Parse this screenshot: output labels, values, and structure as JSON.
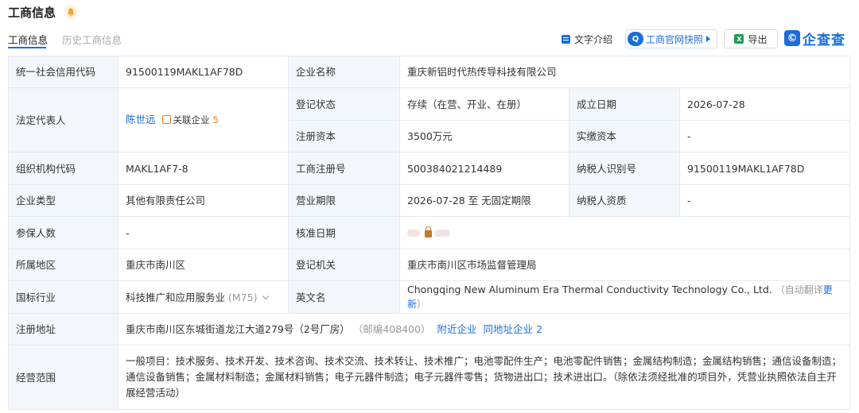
{
  "header": {
    "title": "工商信息"
  },
  "tabs": [
    {
      "label": "工商信息",
      "active": true
    },
    {
      "label": "历史工商信息",
      "active": false
    }
  ],
  "toolbar": {
    "text_intro": "文字介绍",
    "snapshot": "工商官网快照",
    "snapshot_icon": "Q",
    "export": "导出",
    "export_icon": "X",
    "logo_mark": "©",
    "logo_text": "企查查"
  },
  "fields": {
    "credit_code": {
      "label": "统一社会信用代码",
      "value": "91500119MAKL1AF78D"
    },
    "company_name": {
      "label": "企业名称",
      "value": "重庆新铝时代热传导科技有限公司"
    },
    "legal_rep": {
      "label": "法定代表人",
      "value": "陈世远",
      "related_label": "关联企业",
      "related_count": "5"
    },
    "status": {
      "label": "登记状态",
      "value": "存续（在营、开业、在册）"
    },
    "found_date": {
      "label": "成立日期",
      "value": "2026-07-28"
    },
    "reg_capital": {
      "label": "注册资本",
      "value": "3500万元"
    },
    "paid_capital": {
      "label": "实缴资本",
      "value": "-"
    },
    "org_code": {
      "label": "组织机构代码",
      "value": "MAKL1AF7-8"
    },
    "reg_no": {
      "label": "工商注册号",
      "value": "500384021214489"
    },
    "taxpayer_id": {
      "label": "纳税人识别号",
      "value": "91500119MAKL1AF78D"
    },
    "company_type": {
      "label": "企业类型",
      "value": "其他有限责任公司"
    },
    "biz_term": {
      "label": "营业期限",
      "value": "2026-07-28 至 无固定期限"
    },
    "taxpayer_qual": {
      "label": "纳税人资质",
      "value": "-"
    },
    "insured": {
      "label": "参保人数",
      "value": "-"
    },
    "approve_date": {
      "label": "核准日期"
    },
    "region": {
      "label": "所属地区",
      "value": "重庆市南川区"
    },
    "reg_authority": {
      "label": "登记机关",
      "value": "重庆市南川区市场监督管理局"
    },
    "industry": {
      "label": "国标行业",
      "value": "科技推广和应用服务业",
      "code": "(M75)"
    },
    "english_name": {
      "label": "英文名",
      "value": "Chongqing New Aluminum Era Thermal Conductivity Technology Co., Ltd.",
      "note": "（自动翻译",
      "update": "更新",
      "note_end": "）"
    },
    "address": {
      "label": "注册地址",
      "value": "重庆市南川区东城街道龙江大道279号（2号厂房）",
      "postcode": "（邮编408400）",
      "nearby": "附近企业",
      "same_addr": "同地址企业",
      "same_count": "2"
    },
    "scope": {
      "label": "经营范围",
      "value": "一般项目：技术服务、技术开发、技术咨询、技术交流、技术转让、技术推广；电池零配件生产；电池零配件销售；金属结构制造；金属结构销售；通信设备制造；通信设备销售；金属材料制造；金属材料销售；电子元器件制造；电子元器件零售；货物进出口；技术进出口。（除依法须经批准的项目外，凭营业执照依法自主开展经营活动）"
    }
  },
  "colors": {
    "accent": "#1a6ddb",
    "label_bg": "#f3f6fa",
    "border": "#e4e9f0",
    "orange": "#f07a1a"
  }
}
